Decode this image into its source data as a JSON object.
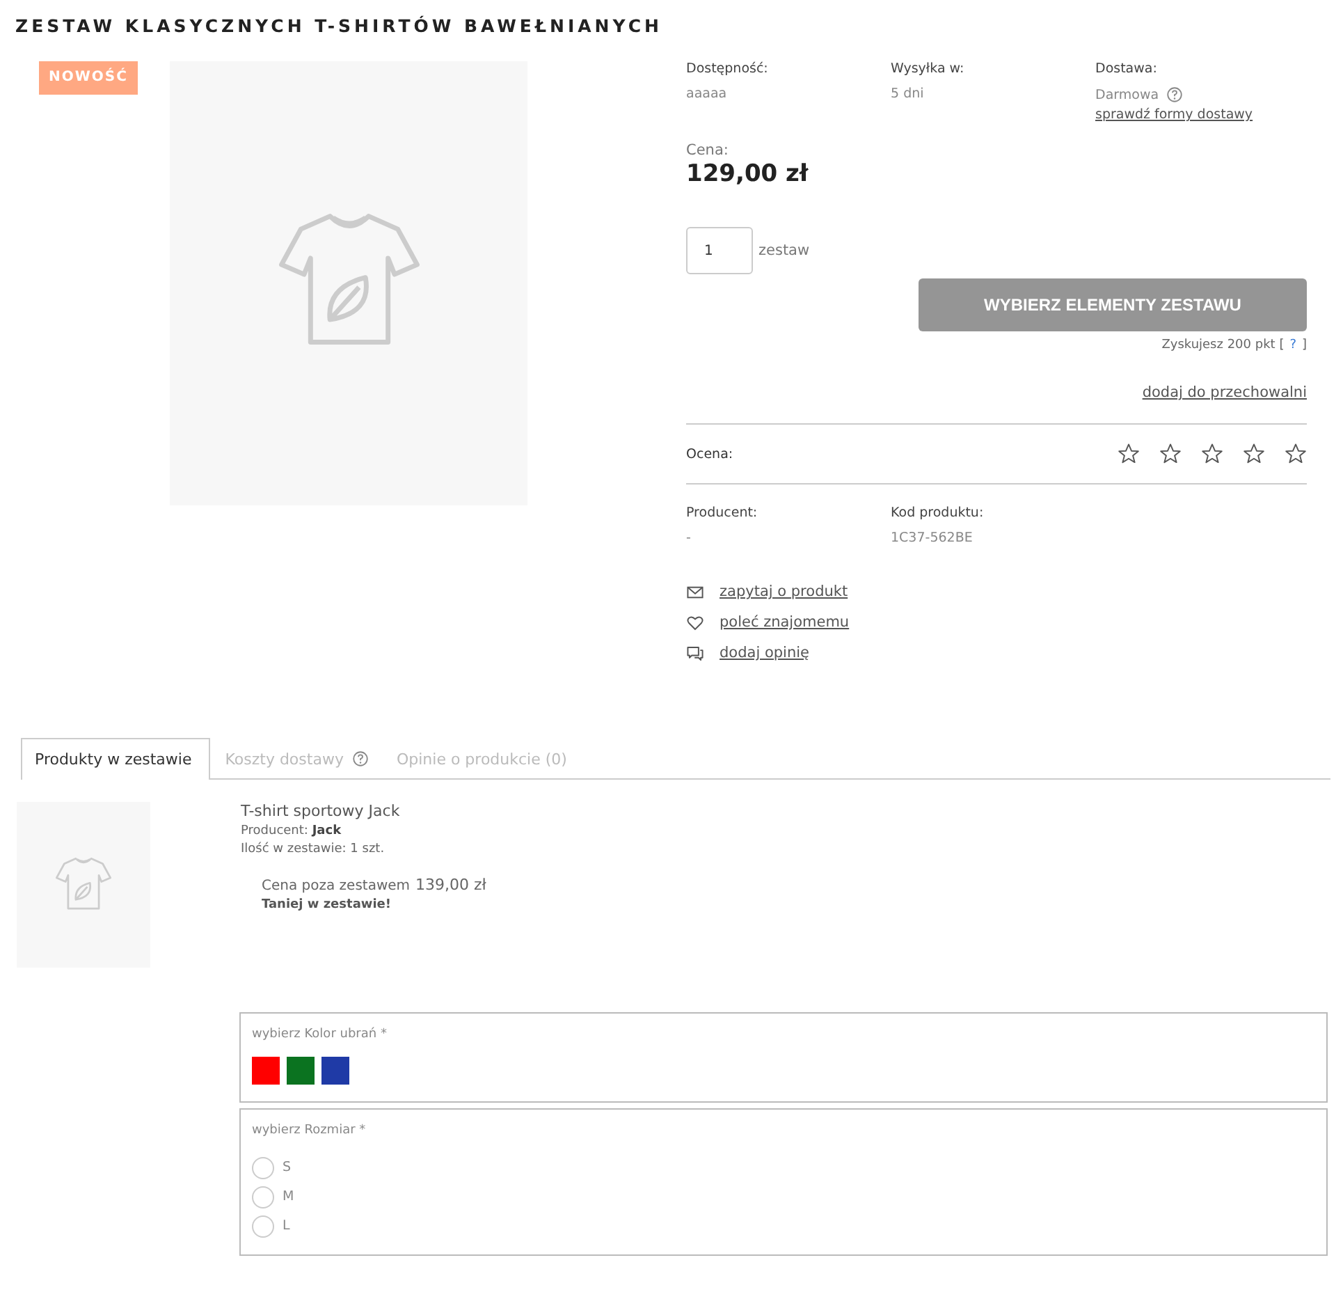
{
  "title": "ZESTAW KLASYCZNYCH T-SHIRTÓW BAWEŁNIANYCH",
  "badge": "NOWOŚĆ",
  "info": [
    {
      "label": "Dostępność:",
      "value": "aaaaa"
    },
    {
      "label": "Wysyłka w:",
      "value": "5 dni"
    },
    {
      "label": "Dostawa:",
      "value": "Darmowa",
      "link": "sprawdź formy dostawy"
    }
  ],
  "price": {
    "label": "Cena:",
    "value": "129,00 zł"
  },
  "quantity": {
    "value": "1",
    "unit": "zestaw"
  },
  "buy_button": "WYBIERZ ELEMENTY ZESTAWU",
  "points": {
    "text": "Zyskujesz 200 pkt [",
    "help": "?",
    "close": "]"
  },
  "storage_link": "dodaj do przechowalni",
  "rating": {
    "label": "Ocena:",
    "stars": 0
  },
  "details": [
    {
      "label": "Producent:",
      "value": "-"
    },
    {
      "label": "Kod produktu:",
      "value": "1C37-562BE"
    }
  ],
  "actions": [
    {
      "kind": "mail",
      "label": "zapytaj o produkt"
    },
    {
      "kind": "heart",
      "label": "poleć znajomemu"
    },
    {
      "kind": "chat",
      "label": "dodaj opinię"
    }
  ],
  "tabs": [
    {
      "label": "Produkty w zestawie",
      "selected": true,
      "help": false
    },
    {
      "label": "Koszty dostawy",
      "selected": false,
      "help": true
    },
    {
      "label": "Opinie o produkcie (0)",
      "selected": false,
      "help": false
    }
  ],
  "bundle_item": {
    "name": "T-shirt sportowy Jack",
    "producer": "Producent: **Jack**",
    "qty": "Ilość w zestawie: 1 szt.",
    "price_label": "Cena poza zestawem",
    "price": "139,00 zł",
    "note": "Taniej w zestawie!"
  },
  "options": [
    {
      "kind": "colors",
      "label": "wybierz Kolor ubrań *",
      "values": [
        {
          "color": "#ff0000",
          "selected": false
        },
        {
          "color": "#0b7320",
          "selected": false
        },
        {
          "color": "#1f3aa6",
          "selected": false
        }
      ]
    },
    {
      "kind": "radios",
      "label": "wybierz Rozmiar *",
      "values": [
        {
          "label": "S",
          "selected": false
        },
        {
          "label": "M",
          "selected": false
        },
        {
          "label": "L",
          "selected": false
        }
      ]
    }
  ]
}
